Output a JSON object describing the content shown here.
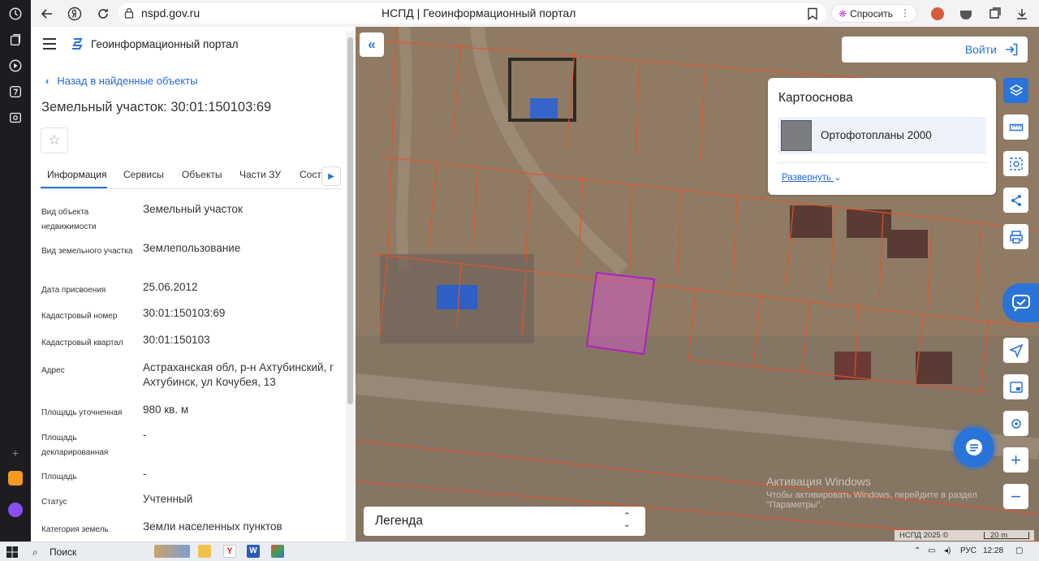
{
  "browser": {
    "url": "nspd.gov.ru",
    "tab_title": "НСПД | Геоинформационный портал",
    "ask_label": "Спросить"
  },
  "panel": {
    "portal_title": "Геоинформационный портал",
    "back_link": "Назад в найденные объекты",
    "object_title": "Земельный участок: 30:01:150103:69",
    "tabs": [
      {
        "label": "Информация",
        "active": true
      },
      {
        "label": "Сервисы"
      },
      {
        "label": "Объекты"
      },
      {
        "label": "Части ЗУ"
      },
      {
        "label": "Соста"
      }
    ],
    "rows": [
      {
        "key": "Вид объекта недвижимости",
        "value": "Земельный участок"
      },
      {
        "key": "Вид земельного участка",
        "value": "Землепользование"
      },
      {
        "key": "Дата присвоения",
        "value": "25.06.2012"
      },
      {
        "key": "Кадастровый номер",
        "value": "30:01:150103:69"
      },
      {
        "key": "Кадастровый квартал",
        "value": "30:01:150103"
      },
      {
        "key": "Адрес",
        "value": "Астраханская обл, р-н Ахтубинский, г Ахтубинск, ул Кочубея, 13"
      },
      {
        "key": "Площадь уточненная",
        "value": "980 кв. м"
      },
      {
        "key": "Площадь декларированная",
        "value": "-"
      },
      {
        "key": "Площадь",
        "value": "-"
      },
      {
        "key": "Статус",
        "value": "Учтенный"
      },
      {
        "key": "Категория земель",
        "value": "Земли населенных пунктов"
      }
    ]
  },
  "map": {
    "login_label": "Войти",
    "basemap": {
      "title": "Картооснова",
      "selected": "Ортофотопланы 2000",
      "expand_label": "Развернуть"
    },
    "legend_label": "Легенда",
    "watermark_line1": "Активация Windows",
    "watermark_line2": "Чтобы активировать Windows, перейдите в раздел \"Параметры\".",
    "copyright": "НСПД 2025 ©",
    "scale": "20 m",
    "colors": {
      "accent": "#2a73d8",
      "parcel_border": "#e0552b",
      "selected_parcel": "#b020c0"
    }
  },
  "taskbar": {
    "search": "Поиск",
    "lang": "РУС",
    "time": "12:28"
  }
}
